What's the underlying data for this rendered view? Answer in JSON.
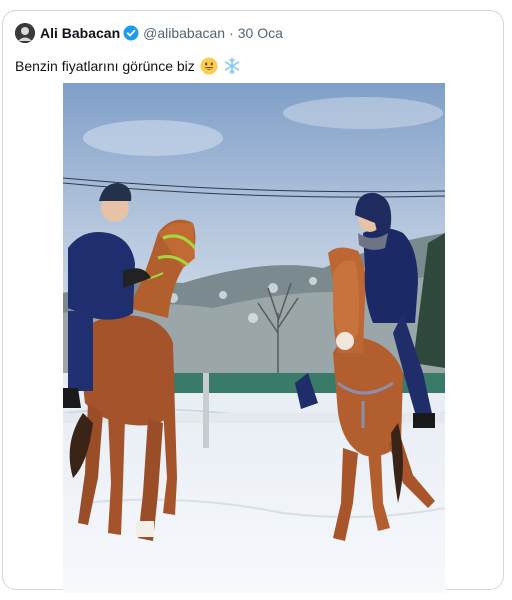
{
  "author": {
    "name": "Ali Babacan",
    "handle": "@alibabacan",
    "separator": "·",
    "date": "30 Oca",
    "verified": true,
    "verified_color": "#1d9bf0"
  },
  "tweet": {
    "text": "Benzin fiyatlarını görünce biz",
    "emojis": [
      "grinning-face-emoji",
      "snowflake-emoji"
    ]
  },
  "media": {
    "description_icon": "photo"
  }
}
